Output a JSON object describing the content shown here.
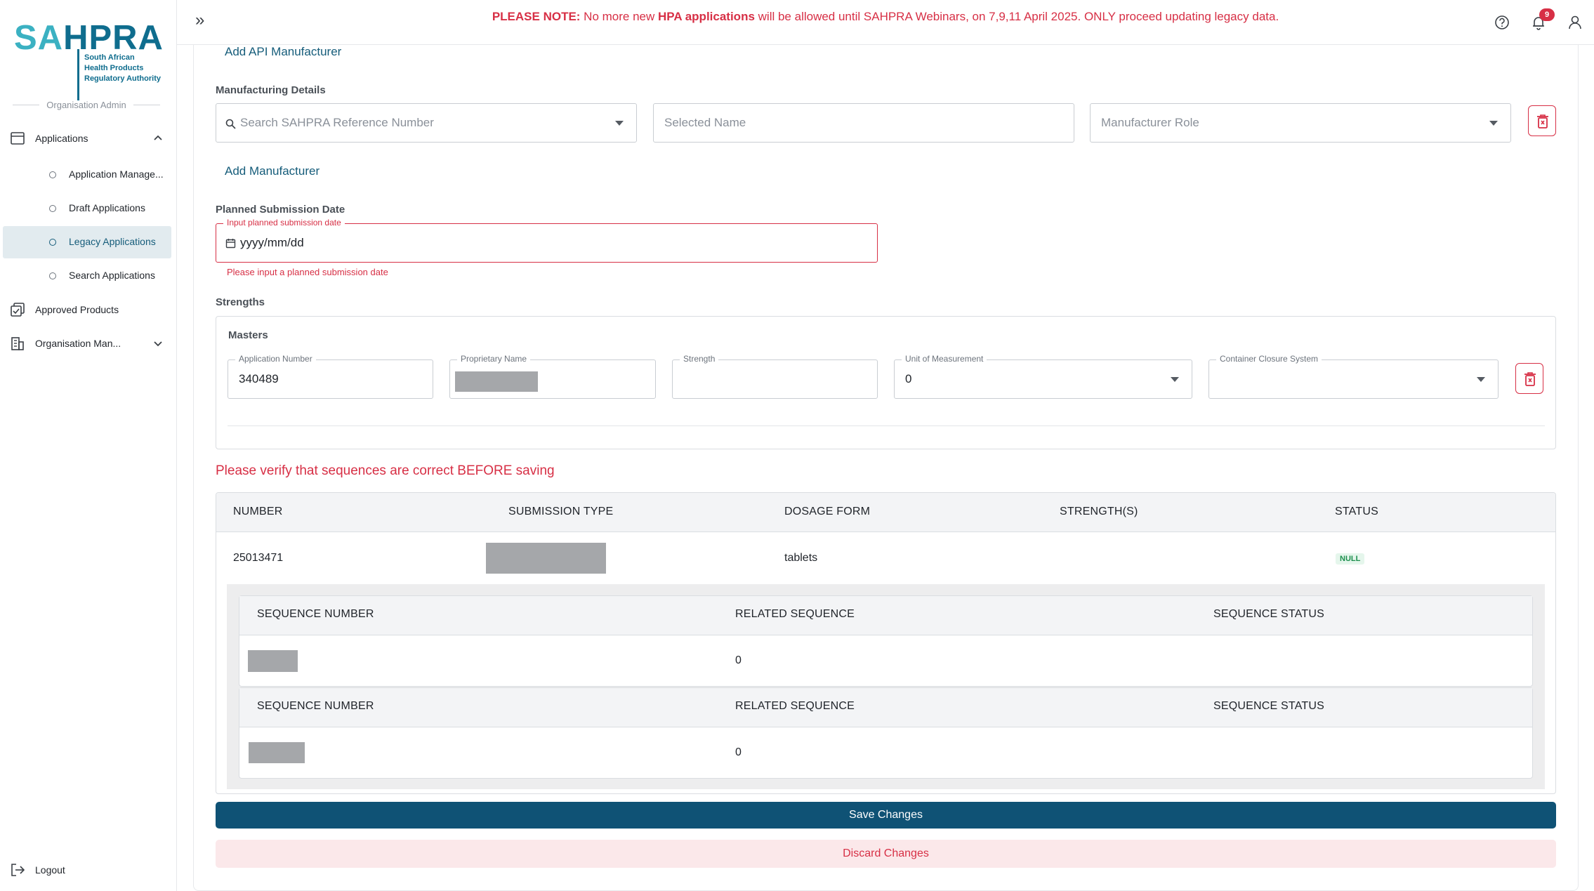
{
  "brand": {
    "logo_short_a": "SA",
    "logo_short_b": "HPRA",
    "logo_line1": "South African",
    "logo_line2": "Health Products",
    "logo_line3": "Regulatory Authority"
  },
  "sidebar": {
    "role": "Organisation Admin",
    "applications": "Applications",
    "sub_items": [
      {
        "label": "Application Manage..."
      },
      {
        "label": "Draft Applications"
      },
      {
        "label": "Legacy Applications"
      },
      {
        "label": "Search Applications"
      }
    ],
    "approved_products": "Approved Products",
    "organisation": "Organisation Man...",
    "logout": "Logout"
  },
  "topbar": {
    "expand": "»",
    "notice_prefix": "PLEASE NOTE:",
    "notice_mid1": " No more new ",
    "notice_bold": "HPA applications",
    "notice_rest": " will be allowed until SAHPRA Webinars, on 7,9,11 April 2025. ONLY proceed updating legacy data.",
    "notification_count": "9"
  },
  "form": {
    "add_api_manufacturer": "Add API Manufacturer",
    "manufacturing_details": "Manufacturing Details",
    "search_ref_placeholder": "Search SAHPRA Reference Number",
    "selected_name_placeholder": "Selected Name",
    "manufacturer_role_placeholder": "Manufacturer Role",
    "add_manufacturer": "Add Manufacturer",
    "planned_submission_date": "Planned Submission Date",
    "planned_date_label": "Input planned submission date",
    "planned_date_placeholder": "yyyy/mm/dd",
    "planned_date_error": "Please input a planned submission date",
    "strengths": "Strengths",
    "masters": "Masters",
    "application_number_label": "Application Number",
    "application_number_value": "340489",
    "proprietary_name_label": "Proprietary Name",
    "strength_label": "Strength",
    "unit_label": "Unit of Measurement",
    "unit_value": "0",
    "container_label": "Container Closure System"
  },
  "warning": "Please verify that sequences are correct BEFORE saving",
  "table": {
    "headers": [
      "NUMBER",
      "SUBMISSION TYPE",
      "DOSAGE FORM",
      "STRENGTH(S)",
      "STATUS"
    ],
    "row": {
      "number": "25013471",
      "dosage_form": "tablets",
      "status": "NULL"
    },
    "seq_headers": [
      "SEQUENCE NUMBER",
      "RELATED SEQUENCE",
      "SEQUENCE STATUS"
    ],
    "sequences": [
      {
        "related": "0"
      },
      {
        "related": "0"
      }
    ]
  },
  "buttons": {
    "save": "Save Changes",
    "discard": "Discard Changes"
  },
  "colors": {
    "primary": "#0f5275",
    "danger": "#d72f45",
    "link": "#155c7a"
  }
}
